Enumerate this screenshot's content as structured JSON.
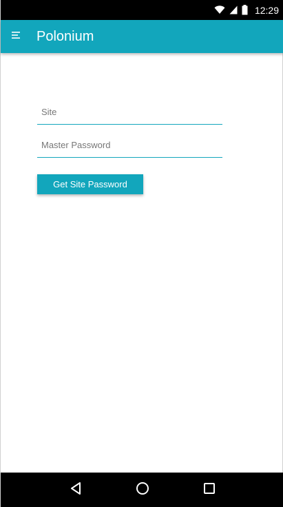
{
  "theme": {
    "accent": "#12a6bc",
    "status_bar_bg": "#000000",
    "nav_bar_bg": "#000000"
  },
  "status_bar": {
    "time": "12:29",
    "icons": [
      "wifi-icon",
      "signal-icon",
      "battery-icon"
    ]
  },
  "app_bar": {
    "menu_icon": "hamburger-menu-icon",
    "title": "Polonium"
  },
  "form": {
    "site": {
      "value": "",
      "placeholder": "Site"
    },
    "master_password": {
      "value": "",
      "placeholder": "Master Password"
    },
    "submit_label": "Get Site Password"
  },
  "nav_bar": {
    "icons": [
      "back-icon",
      "home-icon",
      "recents-icon"
    ]
  }
}
